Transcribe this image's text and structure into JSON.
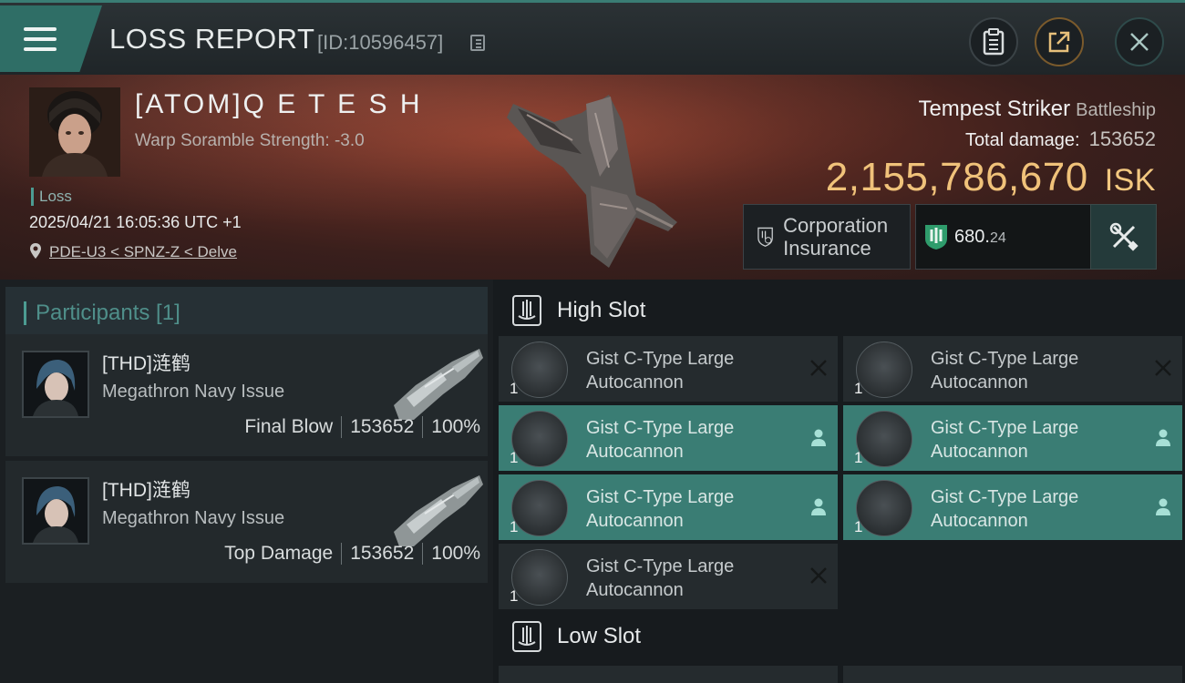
{
  "header": {
    "title": "LOSS REPORT",
    "report_id": "[ID:10596457]"
  },
  "victim": {
    "name": "[ATOM]Q E T E S H",
    "warp_scramble": "Warp Soramble Strength: -3.0",
    "tag": "Loss",
    "datetime": "2025/04/21 16:05:36 UTC +1",
    "location": "PDE-U3 < SPNZ-Z < Delve",
    "ship_name": "Tempest Striker",
    "ship_class": "Battleship",
    "total_damage_label": "Total damage:",
    "total_damage": "153652",
    "isk_value": "2,155,786,670",
    "isk_unit": "ISK",
    "insurance_label": "Corporation Insurance",
    "plex_main": "680.",
    "plex_frac": "24"
  },
  "participants": {
    "title": "Participants [1]",
    "rows": [
      {
        "name": "[THD]涟鹤",
        "ship": "Megathron Navy Issue",
        "role": "Final Blow",
        "damage": "153652",
        "percent": "100%"
      },
      {
        "name": "[THD]涟鹤",
        "ship": "Megathron Navy Issue",
        "role": "Top Damage",
        "damage": "153652",
        "percent": "100%"
      }
    ]
  },
  "slots": {
    "high_label": "High Slot",
    "low_label": "Low Slot",
    "modules": [
      {
        "name": "Gist C-Type Large Autocannon",
        "qty": "1",
        "state": "destroyed"
      },
      {
        "name": "Gist C-Type Large Autocannon",
        "qty": "1",
        "state": "destroyed"
      },
      {
        "name": "Gist C-Type Large Autocannon",
        "qty": "1",
        "state": "dropped"
      },
      {
        "name": "Gist C-Type Large Autocannon",
        "qty": "1",
        "state": "dropped"
      },
      {
        "name": "Gist C-Type Large Autocannon",
        "qty": "1",
        "state": "dropped"
      },
      {
        "name": "Gist C-Type Large Autocannon",
        "qty": "1",
        "state": "dropped"
      },
      {
        "name": "Gist C-Type Large Autocannon",
        "qty": "1",
        "state": "destroyed"
      }
    ]
  },
  "colors": {
    "accent": "#3a7d74",
    "isk": "#f0c27a",
    "banner": "#5c2a22"
  }
}
